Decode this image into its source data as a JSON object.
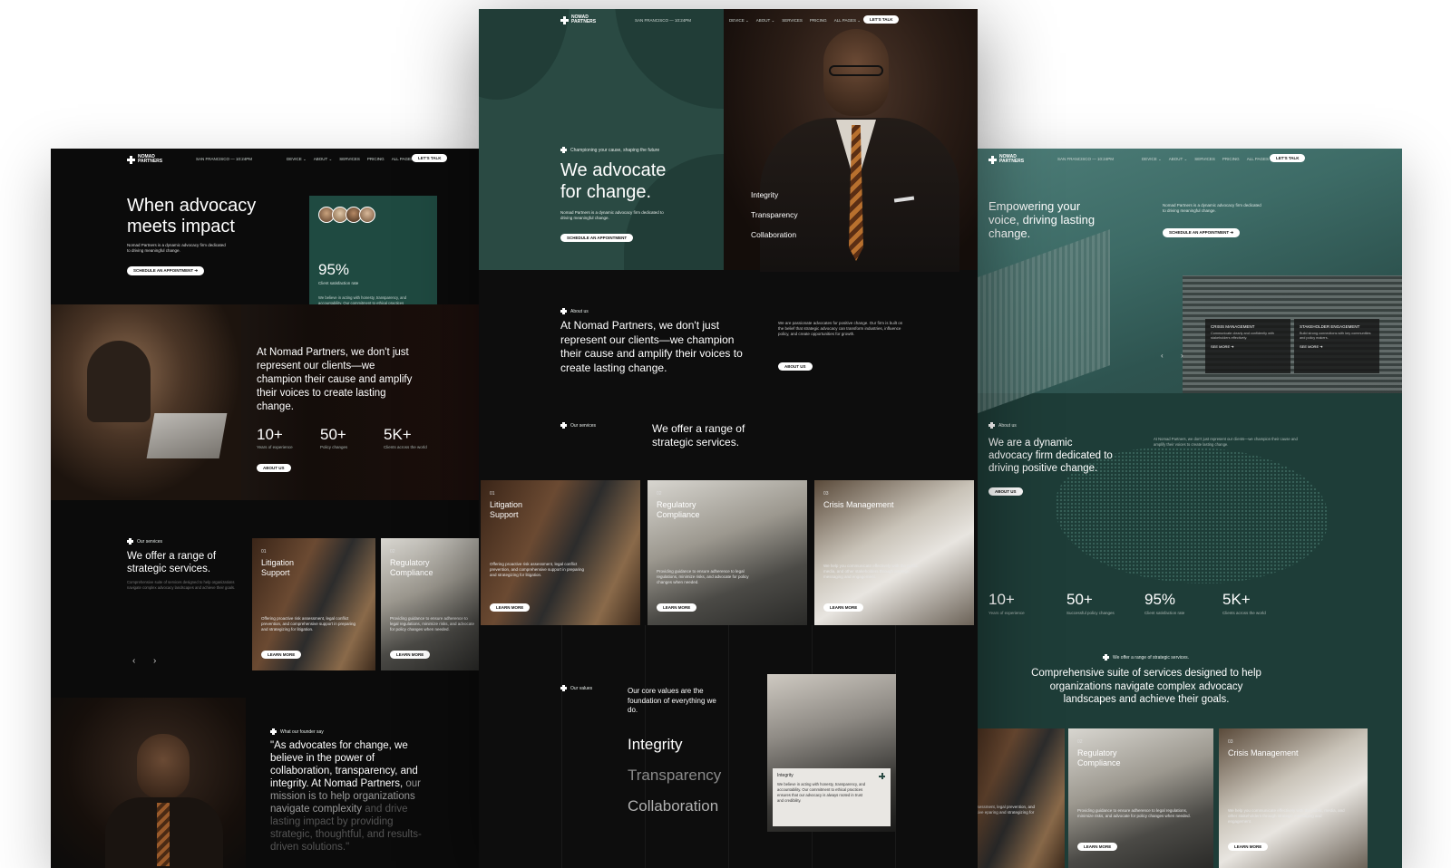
{
  "brand": {
    "line1": "NOMAD",
    "line2": "PARTNERS"
  },
  "nav": {
    "time": "SAN FRANCISCO — 10:24PM",
    "links": [
      "DEVICE ⌄",
      "ABOUT ⌄",
      "SERVICES",
      "PRICING",
      "ALL PAGES ⌄"
    ],
    "cta": "LET'S TALK"
  },
  "left": {
    "hero_title": "When advocacy meets impact",
    "hero_sub": "Nomad Partners is a dynamic advocacy firm dedicated to driving meaningful change.",
    "hero_button": "SCHEDULE AN APPOINTMENT ➔",
    "stat_big": "95%",
    "stat_big_label": "Client satisfaction rate",
    "stat_big_text": "We believe in acting with honesty, transparency, and accountability. Our commitment to ethical practices ensures that our advocacy is always rooted in trust and credibility.",
    "about_text": "At Nomad Partners, we don't just represent our clients—we champion their cause and amplify their voices to create lasting change.",
    "stats": [
      {
        "value": "10+",
        "label": "Years of experience"
      },
      {
        "value": "50+",
        "label": "Policy changes"
      },
      {
        "value": "5K+",
        "label": "Clients across the world"
      }
    ],
    "about_button": "ABOUT US",
    "services_eyebrow": "Our services",
    "services_title": "We offer a range of strategic services.",
    "services_text": "Comprehensive suite of services designed to help organizations navigate complex advocacy landscapes and achieve their goals.",
    "cards": [
      {
        "num": "01",
        "title": "Litigation Support",
        "desc": "Offering proactive risk assessment, legal conflict prevention, and comprehensive support in preparing and strategizing for litigation.",
        "btn": "LEARN MORE"
      },
      {
        "num": "02",
        "title": "Regulatory Compliance",
        "desc": "Providing guidance to ensure adherence to legal regulations, minimize risks, and advocate for policy changes when needed.",
        "btn": "LEARN MORE"
      }
    ],
    "arrows": [
      "‹",
      "›"
    ],
    "founder_eyebrow": "What our founder say",
    "quote_bright": "\"As advocates for change, we believe in the power of collaboration, transparency, and integrity. At Nomad Partners,",
    "quote_mid": "our mission is to help organizations navigate complexity",
    "quote_dim": "and drive lasting impact by providing strategic, thoughtful, and results-driven solutions.\""
  },
  "center": {
    "hero_eyebrow": "Championing your cause, shaping the future",
    "hero_title": "We advocate for change.",
    "hero_sub": "Nomad Partners is a dynamic advocacy firm dedicated to driving meaningful change.",
    "hero_button": "SCHEDULE AN APPOINTMENT",
    "values_list": [
      "Integrity",
      "Transparency",
      "Collaboration"
    ],
    "about_eyebrow": "About us",
    "about_title": "At Nomad Partners, we don't just represent our clients—we champion their cause and amplify their voices to create lasting change.",
    "about_side": "We are passionate advocates for positive change. Our firm is built on the belief that strategic advocacy can transform industries, influence policy, and create opportunities for growth.",
    "about_button": "ABOUT US",
    "services_eyebrow": "Our services",
    "services_title": "We offer a range of strategic services.",
    "cards": [
      {
        "num": "01",
        "title": "Litigation Support",
        "desc": "Offering proactive risk assessment, legal conflict prevention, and comprehensive support in preparing and strategizing for litigation.",
        "btn": "LEARN MORE"
      },
      {
        "num": "02",
        "title": "Regulatory Compliance",
        "desc": "Providing guidance to ensure adherence to legal regulations, minimize risks, and advocate for policy changes when needed.",
        "btn": "LEARN MORE"
      },
      {
        "num": "03",
        "title": "Crisis Management",
        "desc": "We help you communicate effectively with the public, media, and other stakeholders through strategic messaging and engagement.",
        "btn": "LEARN MORE"
      }
    ],
    "values_eyebrow": "Our values",
    "values_intro": "Our core values are the foundation of everything we do.",
    "values_big": [
      "Integrity",
      "Transparency",
      "Collaboration"
    ],
    "value_card_title": "Integrity",
    "value_card_text": "We believe in acting with honesty, transparency, and accountability. Our commitment to ethical practices ensures that our advocacy is always rooted in trust and credibility."
  },
  "right": {
    "hero_title": "Empowering your voice, driving lasting change.",
    "hero_sub": "Nomad Partners is a dynamic advocacy firm dedicated to driving meaningful change.",
    "hero_button": "SCHEDULE AN APPOINTMENT ➔",
    "hero_cards": [
      {
        "title": "CRISIS MANAGEMENT",
        "text": "Communicate clearly and confidently with stakeholders effectively.",
        "link": "SEE MORE ➔"
      },
      {
        "title": "STAKEHOLDER ENGAGEMENT",
        "text": "Build strong connections with key communities and policy makers.",
        "link": "SEE MORE ➔"
      }
    ],
    "arrows": [
      "‹",
      "›"
    ],
    "about_eyebrow": "About us",
    "about_title": "We are a dynamic advocacy firm dedicated to driving positive change.",
    "about_side": "At Nomad Partners, we don't just represent our clients—we champion their cause and amplify their voices to create lasting change.",
    "about_button": "ABOUT US",
    "stats": [
      {
        "value": "10+",
        "label": "Years of experience"
      },
      {
        "value": "50+",
        "label": "Successful policy changes"
      },
      {
        "value": "95%",
        "label": "Client satisfaction rate"
      },
      {
        "value": "5K+",
        "label": "Clients across the world"
      }
    ],
    "services_eyebrow": "We offer a range of strategic services.",
    "services_title": "Comprehensive suite of services designed to help organizations navigate complex advocacy landscapes and achieve their goals.",
    "cards": [
      {
        "num": "",
        "title": "n t",
        "desc": "ctive risk assessment, legal prevention, and comprehensive eparing and strategizing for",
        "btn": ""
      },
      {
        "num": "02",
        "title": "Regulatory Compliance",
        "desc": "Providing guidance to ensure adherence to legal regulations, minimize risks, and advocate for policy changes when needed.",
        "btn": "LEARN MORE"
      },
      {
        "num": "03",
        "title": "Crisis Management",
        "desc": "We help you communicate effectively with the public, media, and other stakeholders through strategic messaging and engagement.",
        "btn": "LEARN MORE"
      }
    ]
  },
  "colors": {
    "dark": "#0d0d0d",
    "green": "#1f4a41",
    "teal": "#2c4d47",
    "accent": "#ffffff"
  }
}
